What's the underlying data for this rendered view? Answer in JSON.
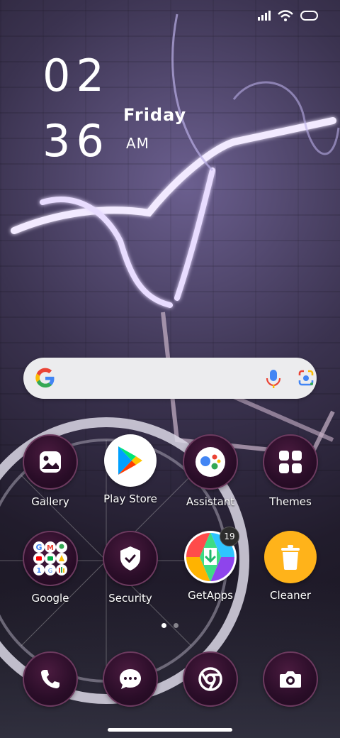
{
  "clock": {
    "hour": "02",
    "minute": "36",
    "day": "Friday",
    "ampm": "AM"
  },
  "status_icons": [
    "signal-icon",
    "wifi-icon",
    "battery-icon"
  ],
  "search": {
    "google_logo": "google-g-icon",
    "mic": "mic-icon",
    "lens": "lens-icon"
  },
  "apps_row1": [
    {
      "label": "Gallery",
      "icon": "gallery-icon"
    },
    {
      "label": "Play Store",
      "icon": "play-store-icon"
    },
    {
      "label": "Assistant",
      "icon": "assistant-icon"
    },
    {
      "label": "Themes",
      "icon": "themes-icon"
    }
  ],
  "apps_row2": [
    {
      "label": "Google",
      "icon": "google-folder-icon"
    },
    {
      "label": "Security",
      "icon": "security-icon"
    },
    {
      "label": "GetApps",
      "icon": "getapps-icon",
      "badge": "19"
    },
    {
      "label": "Cleaner",
      "icon": "cleaner-icon"
    }
  ],
  "dock": [
    {
      "icon": "phone-icon"
    },
    {
      "icon": "messages-icon"
    },
    {
      "icon": "chrome-icon"
    },
    {
      "icon": "camera-icon"
    }
  ],
  "page_indicator": {
    "count": 2,
    "active": 1
  },
  "colors": {
    "icon_bg": "#2a0d28",
    "icon_border": "#6c3a5f",
    "cleaner": "#ffb31a",
    "search_bg": "#ececee"
  }
}
